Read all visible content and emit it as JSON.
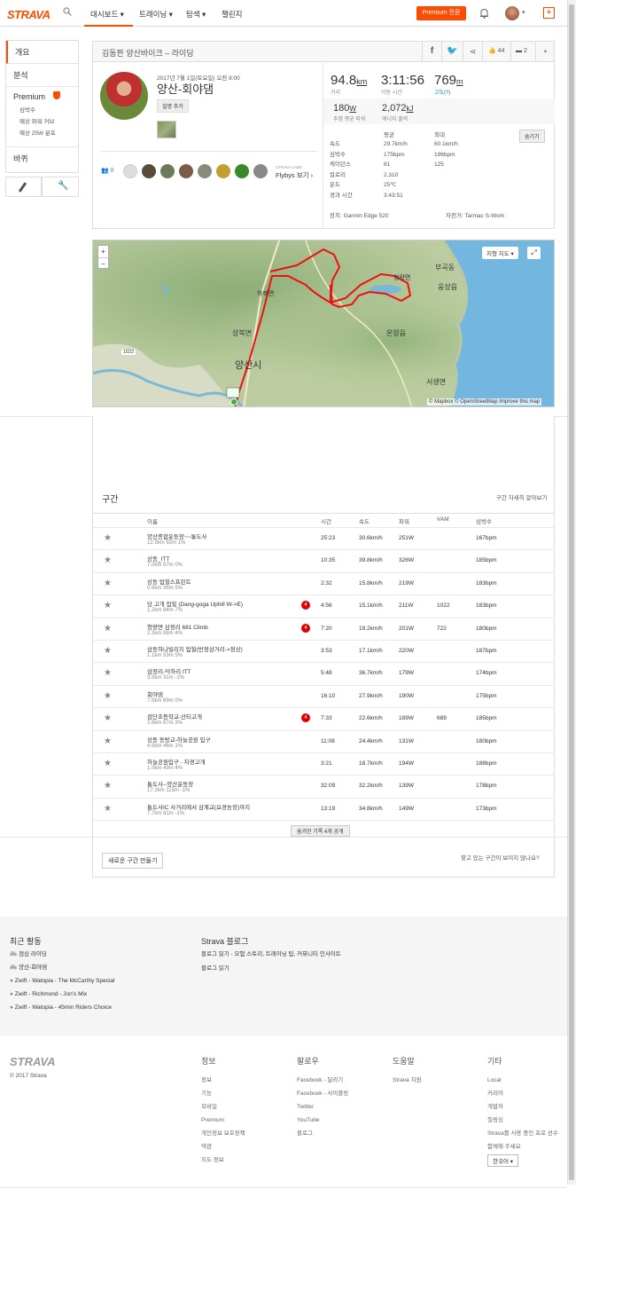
{
  "nav": {
    "logo": "STRAVA",
    "items": [
      "대시보드",
      "트레이닝",
      "탐색",
      "챌린지"
    ],
    "premium": "Premium 전환"
  },
  "sidebar": {
    "overview": "개요",
    "analysis": "분석",
    "premium": "Premium",
    "sub": [
      "심박수",
      "예상 파워 커브",
      "예상 25W 분포"
    ],
    "bike": "바퀴"
  },
  "header": {
    "title": "김동판 양산바이크 – 라이딩",
    "kudos": "44",
    "comments": "2"
  },
  "activity": {
    "date": "2017년 7월 1일(토요일) 오전 8:00",
    "name": "양산-회야댐",
    "add_desc": "설명 추가",
    "kudoers_count": "8",
    "flybys_lab": "STRAVA LABS",
    "flybys": "Flybys 보기"
  },
  "stats": {
    "distance": "94.8",
    "distance_unit": "km",
    "distance_lbl": "거리",
    "moving": "3:11:56",
    "moving_lbl": "이동 시간",
    "elev": "769",
    "elev_unit": "m",
    "elev_lbl": "고도(?)",
    "power": "180",
    "power_unit": "W",
    "power_lbl": "추정 평균 파워",
    "energy": "2,072",
    "energy_unit": "kJ",
    "energy_lbl": "에너지 출력"
  },
  "detail": {
    "avg_h": "평균",
    "max_h": "최대",
    "hide": "숨기기",
    "rows": [
      {
        "l": "속도",
        "a": "29.7km/h",
        "m": "60.1km/h"
      },
      {
        "l": "심박수",
        "a": "175bpm",
        "m": "196bpm"
      },
      {
        "l": "케이던스",
        "a": "81",
        "m": "125"
      },
      {
        "l": "칼로리",
        "a": "2,310",
        "m": ""
      },
      {
        "l": "온도",
        "a": "25℃",
        "m": ""
      },
      {
        "l": "경과 시간",
        "a": "3:43:51",
        "m": ""
      }
    ],
    "device": "장치: Garmin Edge 520",
    "bike": "자전거: Tarmac S-Work"
  },
  "map": {
    "type_btn": "지형 지도",
    "attrib": "© Mapbox © OpenStreetMap Improve this map",
    "labels": [
      "하북면",
      "상북면",
      "양산시",
      "부곡동",
      "청량면",
      "웅상읍",
      "온양읍",
      "서생면",
      "1022"
    ]
  },
  "segments": {
    "title": "구간",
    "detail_link": "구간 자세히 알아보기",
    "cols": [
      "이름",
      "시간",
      "속도",
      "파워",
      "VAM",
      "심박수"
    ],
    "rows": [
      {
        "name": "양산종합운동장~~통도사",
        "sub": "12.9km   92m   1%",
        "time": "25:23",
        "speed": "30.6km/h",
        "power": "251W",
        "vam": "",
        "hr": "167bpm",
        "kom": ""
      },
      {
        "name": "상동_ITT",
        "sub": "7.0km   57m   0%",
        "time": "10:35",
        "speed": "39.8km/h",
        "power": "326W",
        "vam": "",
        "hr": "185bpm",
        "kom": ""
      },
      {
        "name": "상동 업힐스프린트",
        "sub": "0.6km   36m   5%",
        "time": "2:32",
        "speed": "15.8km/h",
        "power": "219W",
        "vam": "",
        "hr": "183bpm",
        "kom": ""
      },
      {
        "name": "당 고개 업힐 (Dang-goga Uphill W->E)",
        "sub": "1.2km   84m   7%",
        "time": "4:56",
        "speed": "15.1km/h",
        "power": "211W",
        "vam": "1022",
        "hr": "183bpm",
        "kom": "4"
      },
      {
        "name": "청량면 삼정리 681 Climb",
        "sub": "2.3km   88m   4%",
        "time": "7:20",
        "speed": "19.2km/h",
        "power": "201W",
        "vam": "722",
        "hr": "180bpm",
        "kom": "4"
      },
      {
        "name": "삼동하나빌리지 업힐(반정삼거리->정상)",
        "sub": "1.1km   53m   5%",
        "time": "3:53",
        "speed": "17.1km/h",
        "power": "220W",
        "vam": "",
        "hr": "187bpm",
        "kom": ""
      },
      {
        "name": "삼정리-덕하리 ITT",
        "sub": "3.5km   31m   -1%",
        "time": "5:48",
        "speed": "36.7km/h",
        "power": "179W",
        "vam": "",
        "hr": "174bpm",
        "kom": ""
      },
      {
        "name": "회야댐",
        "sub": "7.5km   69m   0%",
        "time": "16:10",
        "speed": "27.9km/h",
        "power": "190W",
        "vam": "",
        "hr": "175bpm",
        "kom": ""
      },
      {
        "name": "검단초등학교-산티고개",
        "sub": "2.8km   87m   3%",
        "time": "7:33",
        "speed": "22.6km/h",
        "power": "189W",
        "vam": "689",
        "hr": "185bpm",
        "kom": "4"
      },
      {
        "name": "상동 동방교-하늘공원 입구",
        "sub": "4.5km   46m   1%",
        "time": "11:08",
        "speed": "24.4km/h",
        "power": "131W",
        "vam": "",
        "hr": "180bpm",
        "kom": ""
      },
      {
        "name": "하늘공원입구 - 차경고개",
        "sub": "1.0km   49m   4%",
        "time": "3:21",
        "speed": "18.7km/h",
        "power": "194W",
        "vam": "",
        "hr": "188bpm",
        "kom": ""
      },
      {
        "name": "통도사--양산운동장",
        "sub": "17.2km   115m   -1%",
        "time": "32:09",
        "speed": "32.2km/h",
        "power": "139W",
        "vam": "",
        "hr": "178bpm",
        "kom": ""
      },
      {
        "name": "통도사IC 사거리에서 삼계교(요경농장)까지",
        "sub": "7.7km   81m   -1%",
        "time": "13:19",
        "speed": "34.8km/h",
        "power": "149W",
        "vam": "",
        "hr": "173bpm",
        "kom": ""
      }
    ],
    "hidden_btn": "숨겨진 기록 4개 공개",
    "new_btn": "새로운 구간 만들기",
    "missing": "찾고 있는 구간이 보이지 않나요?"
  },
  "recent": {
    "title": "최근 활동",
    "items": [
      "점심 라이딩",
      "양산-회야댐",
      "Zwift - Watopia - The McCarthy Special",
      "Zwift - Richmond - Jon's Mix",
      "Zwift - Watopia - 45min Riders Choice"
    ]
  },
  "blog": {
    "title": "Strava 블로그",
    "desc": "블로그 읽기 - 모험 스토리, 트레이닝 팁, 커뮤니티 인사이트",
    "link": "블로그 읽기"
  },
  "footer": {
    "logo": "STRAVA",
    "copy": "© 2017 Strava",
    "cols": [
      {
        "h": "정보",
        "items": [
          "정보",
          "기능",
          "모바일",
          "Premium",
          "개인정보 보호정책",
          "약관",
          "지도 정보"
        ]
      },
      {
        "h": "팔로우",
        "items": [
          "Facebook - 달리기",
          "Facebook - 사이클링",
          "Twitter",
          "YouTube",
          "블로그"
        ]
      },
      {
        "h": "도움말",
        "items": [
          "Strava 지원"
        ]
      },
      {
        "h": "기타",
        "items": [
          "Local",
          "커리어",
          "개발자",
          "질링싱",
          "Strava를 사용 중인 프로 선수",
          "함께해 주세요"
        ]
      }
    ],
    "lang": "한국어"
  }
}
